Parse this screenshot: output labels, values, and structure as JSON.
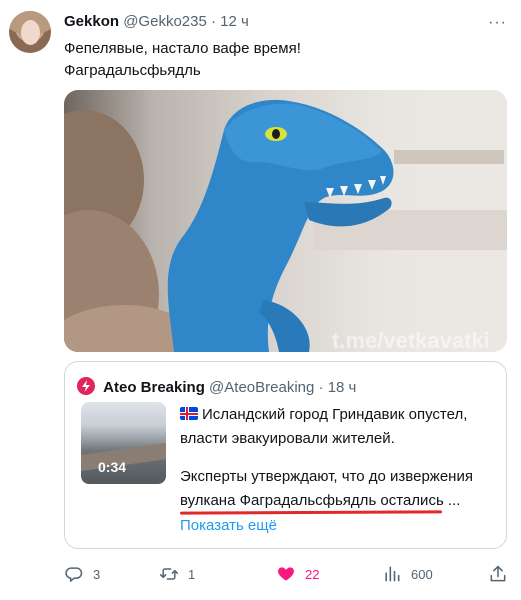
{
  "tweet": {
    "author_name": "Gekkon",
    "handle": "@Gekko235",
    "separator": "·",
    "time": "12 ч",
    "more_label": "···",
    "line1": "Фепелявые,  настало вафе время!",
    "line2": "Фаградальсфьядль"
  },
  "quote": {
    "author_name": "Ateo Breaking",
    "handle": "@AteoBreaking",
    "separator": "·",
    "time": "18 ч",
    "video_duration": "0:34",
    "line1": "Исландский город Гриндавик опустел,",
    "line2": "власти эвакуировали жителей.",
    "line3": "Эксперты утверждают, что до извержения",
    "line4": "вулкана Фаградальсфьядль остались ...",
    "show_more": "Показать ещё"
  },
  "media": {
    "watermark": "t.me/vetkavatki"
  },
  "actions": {
    "replies": "3",
    "retweets": "1",
    "likes": "22",
    "views": "600"
  },
  "colors": {
    "accent": "#1d9bf0",
    "like": "#f91880",
    "underline": "#e3282c",
    "dino": "#2f86c8"
  }
}
